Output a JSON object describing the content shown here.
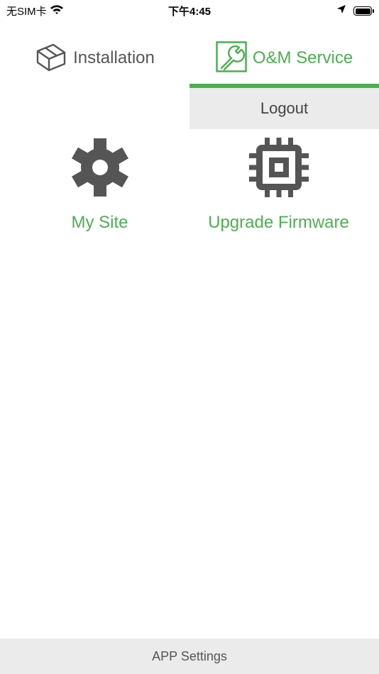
{
  "status_bar": {
    "carrier": "无SIM卡",
    "time": "下午4:45",
    "icons": [
      "wifi-icon",
      "location-arrow-icon",
      "battery-icon"
    ]
  },
  "tabs": [
    {
      "label": "Installation",
      "icon": "box-icon",
      "active": false
    },
    {
      "label": "O&M Service",
      "icon": "wrench-icon",
      "active": true
    }
  ],
  "menu": {
    "logout_label": "Logout"
  },
  "tiles": [
    {
      "label": "My Site",
      "icon": "gear-icon"
    },
    {
      "label": "Upgrade Firmware",
      "icon": "chip-icon"
    }
  ],
  "footer": {
    "settings_label": "APP Settings"
  },
  "colors": {
    "accent": "#4caf50",
    "icon_gray": "#555555",
    "panel_gray": "#ebebeb"
  }
}
